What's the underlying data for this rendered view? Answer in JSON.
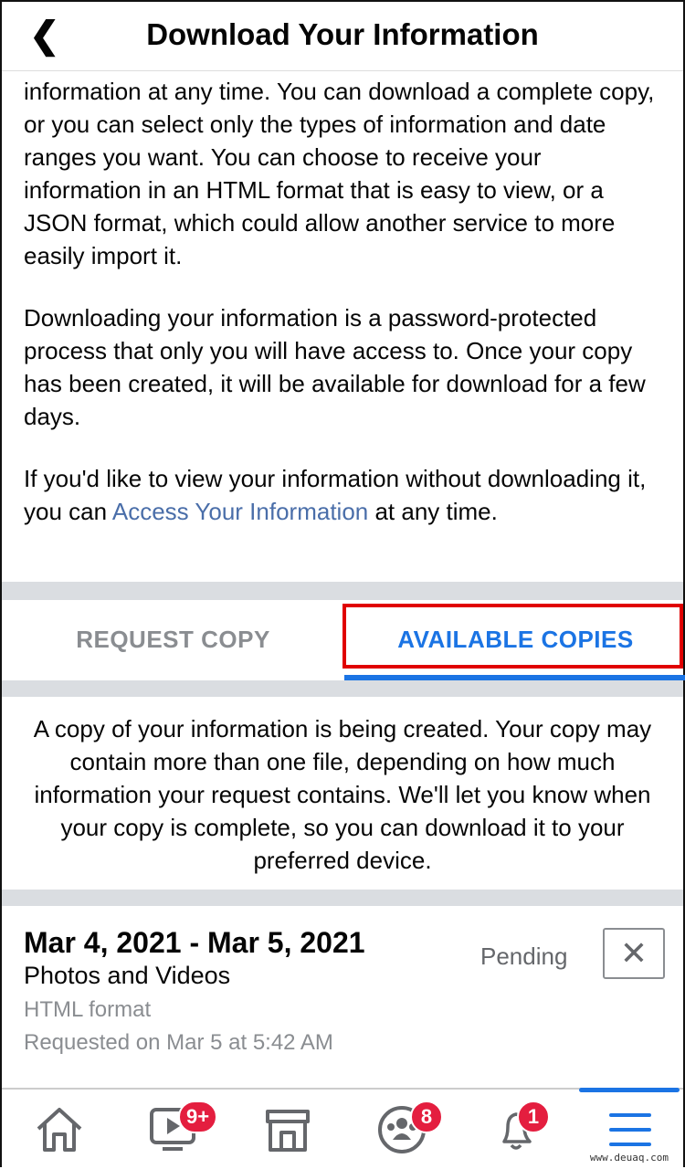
{
  "header": {
    "title": "Download Your Information",
    "back_icon": "chevron-left-icon"
  },
  "intro": {
    "p1": "information at any time. You can download a complete copy, or you can select only the types of information and date ranges you want. You can choose to receive your information in an HTML format that is easy to view, or a JSON format, which could allow another service to more easily import it.",
    "p2": "Downloading your information is a password-protected process that only you will have access to. Once your copy has been created, it will be available for download for a few days.",
    "p3_before": "If you'd like to view your information without downloading it, you can ",
    "p3_link": "Access Your Information",
    "p3_after": " at any time."
  },
  "tabs": [
    {
      "label": "REQUEST COPY",
      "active": false
    },
    {
      "label": "AVAILABLE COPIES",
      "active": true
    }
  ],
  "message": "A copy of your information is being created. Your copy may contain more than one file, depending on how much information your request contains. We'll let you know when your copy is complete, so you can download it to your preferred device.",
  "copy": {
    "dates": "Mar 4, 2021 - Mar 5, 2021",
    "category": "Photos and Videos",
    "format": "HTML format",
    "requested": "Requested on Mar 5 at 5:42 AM",
    "status": "Pending"
  },
  "nav": {
    "watch_badge": "9+",
    "groups_badge": "8",
    "notifications_badge": "1"
  },
  "watermark": "www.deuaq.com",
  "colors": {
    "accent": "#1b74e4",
    "badge": "#e41e3f",
    "highlight": "#e00000",
    "link": "#4a6ea9"
  }
}
